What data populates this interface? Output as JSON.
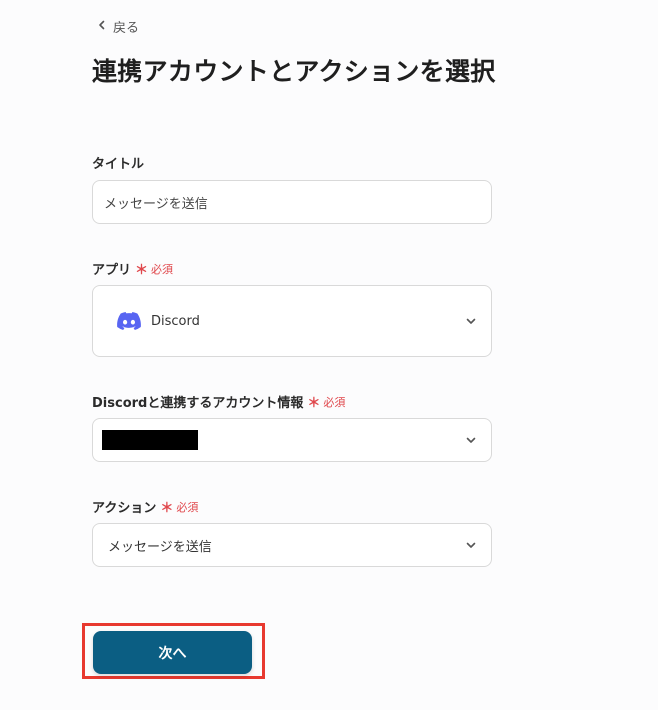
{
  "header": {
    "back_label": "戻る",
    "title": "連携アカウントとアクションを選択"
  },
  "form": {
    "required_mark": "＊",
    "required_text": "必須",
    "title_field": {
      "label": "タイトル",
      "value": "メッセージを送信"
    },
    "app_field": {
      "label": "アプリ",
      "value": "Discord",
      "icon": "discord-logo-icon"
    },
    "account_field": {
      "label": "Discordと連携するアカウント情報",
      "value_redacted": true
    },
    "action_field": {
      "label": "アクション",
      "value": "メッセージを送信"
    }
  },
  "footer": {
    "next_label": "次へ"
  },
  "colors": {
    "primary_button": "#0b5e83",
    "required": "#e0474c",
    "discord": "#5865f2",
    "highlight": "#e8392f"
  }
}
